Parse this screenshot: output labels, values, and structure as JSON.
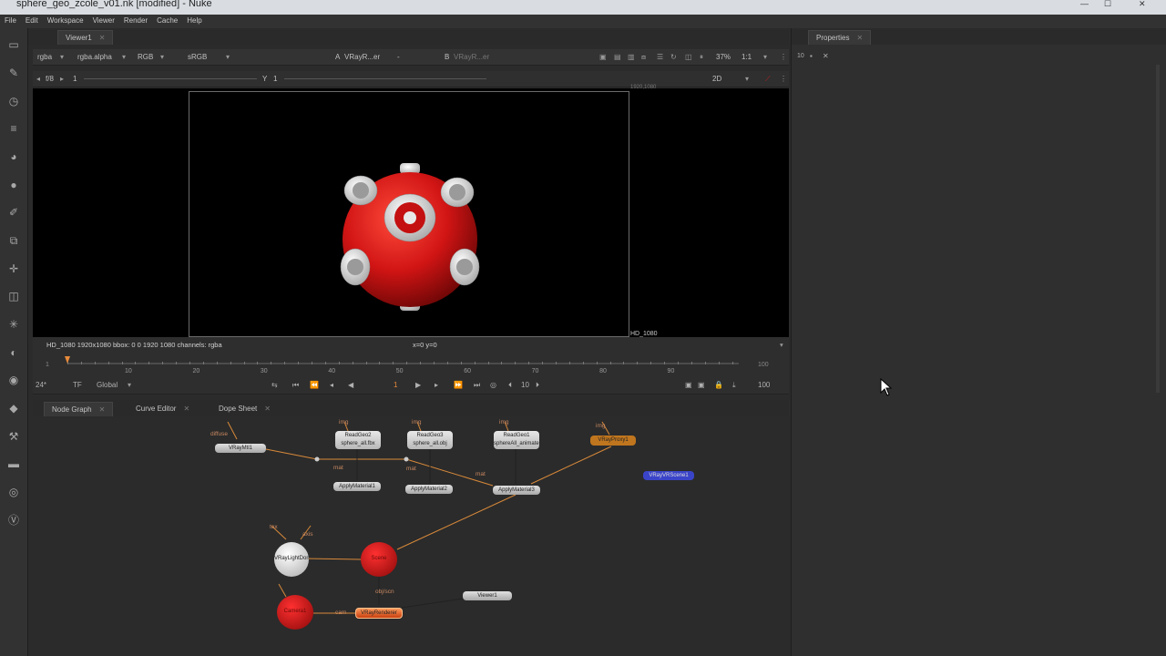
{
  "window": {
    "title": "sphere_geo_zcole_v01.nk [modified] - Nuke"
  },
  "menu": [
    "File",
    "Edit",
    "Workspace",
    "Viewer",
    "Render",
    "Cache",
    "Help"
  ],
  "toolbar_icons": [
    "viewer-icon",
    "paint-icon",
    "time-icon",
    "channel-icon",
    "color-icon",
    "filter-icon",
    "draw-icon",
    "merge-icon",
    "transform-icon",
    "3d-icon",
    "particles-icon",
    "deep-icon",
    "views-icon",
    "metadata-icon",
    "toolsets-icon",
    "other-icon",
    "furnace-icon",
    "vray-icon"
  ],
  "viewer_panel": {
    "tab": "Viewer1",
    "toolbar": {
      "channels": "rgba",
      "alpha": "rgba.alpha",
      "display": "RGB",
      "lut": "sRGB",
      "input_a_label": "A",
      "input_a": "VRayR...er",
      "input_a_op": "-",
      "input_b_label": "B",
      "input_b": "VRayR...er",
      "zoom": "37%",
      "ratio": "1:1",
      "mode": "2D",
      "fstop": "f/8",
      "exposure": "1",
      "gamma_label": "Y",
      "gamma": "1"
    },
    "format_top": "1920,1080",
    "format_label": "HD_1080",
    "status": "HD_1080 1920x1080  bbox: 0 0 1920 1080 channels: rgba",
    "coords": "x=0 y=0"
  },
  "timeline": {
    "start": "1",
    "end": "100",
    "ticks": [
      "1",
      "10",
      "20",
      "30",
      "40",
      "50",
      "60",
      "70",
      "80",
      "90",
      "100"
    ],
    "current_frame": "1",
    "fps": "24*",
    "tf": "TF",
    "scope": "Global",
    "step": "10",
    "end_frame": "100"
  },
  "bottom_tabs": [
    "Node Graph",
    "Curve Editor",
    "Dope Sheet"
  ],
  "nodes": {
    "vraymtl": "VRayMtl1",
    "diffuse_label": "diffuse",
    "readgeo2": "ReadGeo2\nsphere_all.fbx",
    "readgeo3": "ReadGeo3\nsphere_all.obj",
    "readgeo1": "ReadGeo1\nsphereAll_animate_v02.abc",
    "proxy": "VRayProxy1",
    "vrscene": "VRayVRScene1",
    "applymat1": "ApplyMaterial1",
    "applymat2": "ApplyMaterial2",
    "applymat3": "ApplyMaterial3",
    "img_label": "img",
    "mat_label": "mat",
    "tex_label": "tex",
    "axis_label": "axis",
    "lightdome": "VRayLightDome",
    "scene": "Scene",
    "camera": "Camera1",
    "renderer": "VRayRenderer",
    "viewer": "Viewer1",
    "cam_label": "cam",
    "obj_scn_label": "obj/scn"
  },
  "properties": {
    "tab": "Properties",
    "count": "10"
  },
  "colors": {
    "accent_orange": "#d8893a",
    "sphere_red": "#c81818",
    "scene_blue": "#3a44c8"
  }
}
